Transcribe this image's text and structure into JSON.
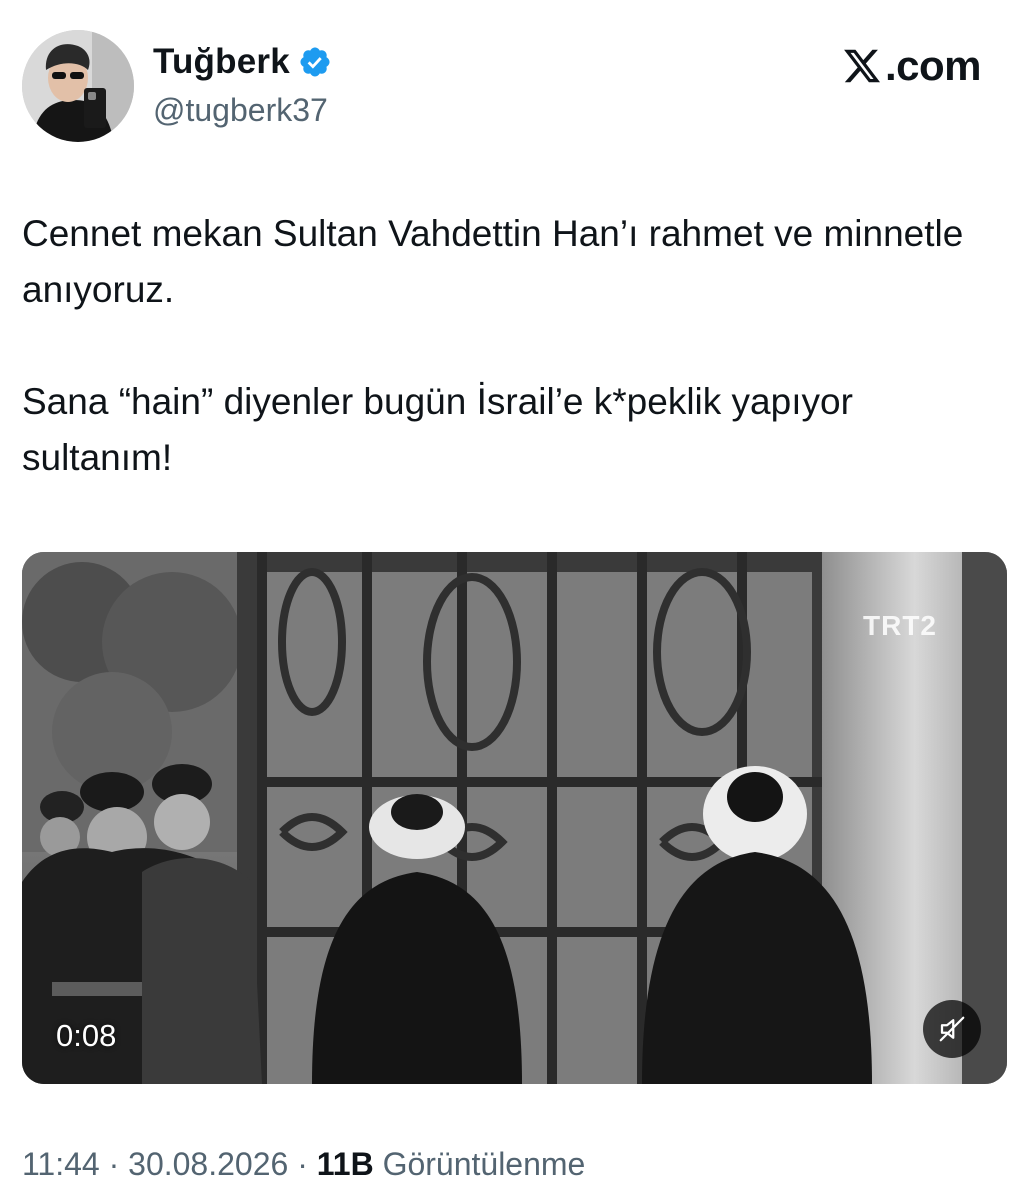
{
  "author": {
    "display_name": "Tuğberk",
    "handle": "@tugberk37",
    "verified": true,
    "verified_color": "#1d9bf0"
  },
  "brand": {
    "text": ".com"
  },
  "tweet": {
    "paragraphs": [
      "Cennet mekan Sultan Vahdettin Han’ı rahmet ve minnetle anıyoruz.",
      "Sana “hain” diyenler bugün İsrail’e k*peklik yapıyor sultanım!"
    ]
  },
  "media": {
    "type": "video",
    "duration": "0:08",
    "watermark": "TRT2",
    "mute_icon": "speaker-muted-icon"
  },
  "meta": {
    "time": "11:44",
    "separator": "·",
    "date": "30.08.2026",
    "views_count": "11B",
    "views_label": "Görüntülenme"
  },
  "colors": {
    "text": "#0f1419",
    "secondary": "#536471",
    "background": "#ffffff"
  }
}
